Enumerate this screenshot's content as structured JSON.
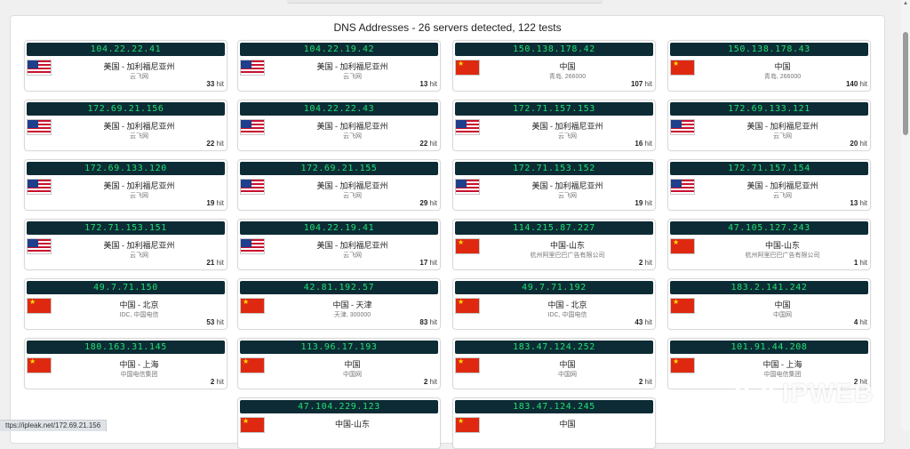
{
  "title": "DNS Addresses - 26 servers detected, 122 tests",
  "hit_label": "hit",
  "status_url": "ttps://ipleak.net/172.69.21.156",
  "watermark": {
    "text": "IPWEB"
  },
  "servers": [
    {
      "ip": "104.22.22.41",
      "flag": "us",
      "country": "美国 - 加利福尼亚州",
      "isp": "云飞网",
      "hits": 33
    },
    {
      "ip": "104.22.19.42",
      "flag": "us",
      "country": "美国 - 加利福尼亚州",
      "isp": "云飞网",
      "hits": 13
    },
    {
      "ip": "150.138.178.42",
      "flag": "cn",
      "country": "中国",
      "isp": "青岛, 266000",
      "hits": 107
    },
    {
      "ip": "150.138.178.43",
      "flag": "cn",
      "country": "中国",
      "isp": "青岛, 266000",
      "hits": 140
    },
    {
      "ip": "172.69.21.156",
      "flag": "us",
      "country": "美国 - 加利福尼亚州",
      "isp": "云飞网",
      "hits": 22
    },
    {
      "ip": "104.22.22.43",
      "flag": "us",
      "country": "美国 - 加利福尼亚州",
      "isp": "云飞网",
      "hits": 22
    },
    {
      "ip": "172.71.157.153",
      "flag": "us",
      "country": "美国 - 加利福尼亚州",
      "isp": "云飞网",
      "hits": 16
    },
    {
      "ip": "172.69.133.121",
      "flag": "us",
      "country": "美国 - 加利福尼亚州",
      "isp": "云飞网",
      "hits": 20
    },
    {
      "ip": "172.69.133.120",
      "flag": "us",
      "country": "美国 - 加利福尼亚州",
      "isp": "云飞网",
      "hits": 19
    },
    {
      "ip": "172.69.21.155",
      "flag": "us",
      "country": "美国 - 加利福尼亚州",
      "isp": "云飞网",
      "hits": 29
    },
    {
      "ip": "172.71.153.152",
      "flag": "us",
      "country": "美国 - 加利福尼亚州",
      "isp": "云飞网",
      "hits": 19
    },
    {
      "ip": "172.71.157.154",
      "flag": "us",
      "country": "美国 - 加利福尼亚州",
      "isp": "云飞网",
      "hits": 13
    },
    {
      "ip": "172.71.153.151",
      "flag": "us",
      "country": "美国 - 加利福尼亚州",
      "isp": "云飞网",
      "hits": 21
    },
    {
      "ip": "104.22.19.41",
      "flag": "us",
      "country": "美国 - 加利福尼亚州",
      "isp": "云飞网",
      "hits": 17
    },
    {
      "ip": "114.215.87.227",
      "flag": "cn",
      "country": "中国-山东",
      "isp": "杭州阿里巴巴广告有限公司",
      "hits": 2
    },
    {
      "ip": "47.105.127.243",
      "flag": "cn",
      "country": "中国-山东",
      "isp": "杭州阿里巴巴广告有限公司",
      "hits": 1
    },
    {
      "ip": "49.7.71.150",
      "flag": "cn",
      "country": "中国 - 北京",
      "isp": "IDC, 中国电信",
      "hits": 53
    },
    {
      "ip": "42.81.192.57",
      "flag": "cn",
      "country": "中国 - 天津",
      "isp": "天津, 300000",
      "hits": 83
    },
    {
      "ip": "49.7.71.192",
      "flag": "cn",
      "country": "中国 - 北京",
      "isp": "IDC, 中国电信",
      "hits": 43
    },
    {
      "ip": "183.2.141.242",
      "flag": "cn",
      "country": "中国",
      "isp": "中国网",
      "hits": 4
    },
    {
      "ip": "180.163.31.145",
      "flag": "cn",
      "country": "中国 - 上海",
      "isp": "中国电信集团",
      "hits": 2
    },
    {
      "ip": "113.96.17.193",
      "flag": "cn",
      "country": "中国",
      "isp": "中国网",
      "hits": 2
    },
    {
      "ip": "183.47.124.252",
      "flag": "cn",
      "country": "中国",
      "isp": "中国网",
      "hits": 2
    },
    {
      "ip": "101.91.44.208",
      "flag": "cn",
      "country": "中国 - 上海",
      "isp": "中国电信集团",
      "hits": 2
    },
    {
      "ip": "47.104.229.123",
      "flag": "cn",
      "country": "中国-山东",
      "isp": "",
      "hits": null
    },
    {
      "ip": "183.47.124.245",
      "flag": "cn",
      "country": "中国",
      "isp": "",
      "hits": null
    }
  ]
}
